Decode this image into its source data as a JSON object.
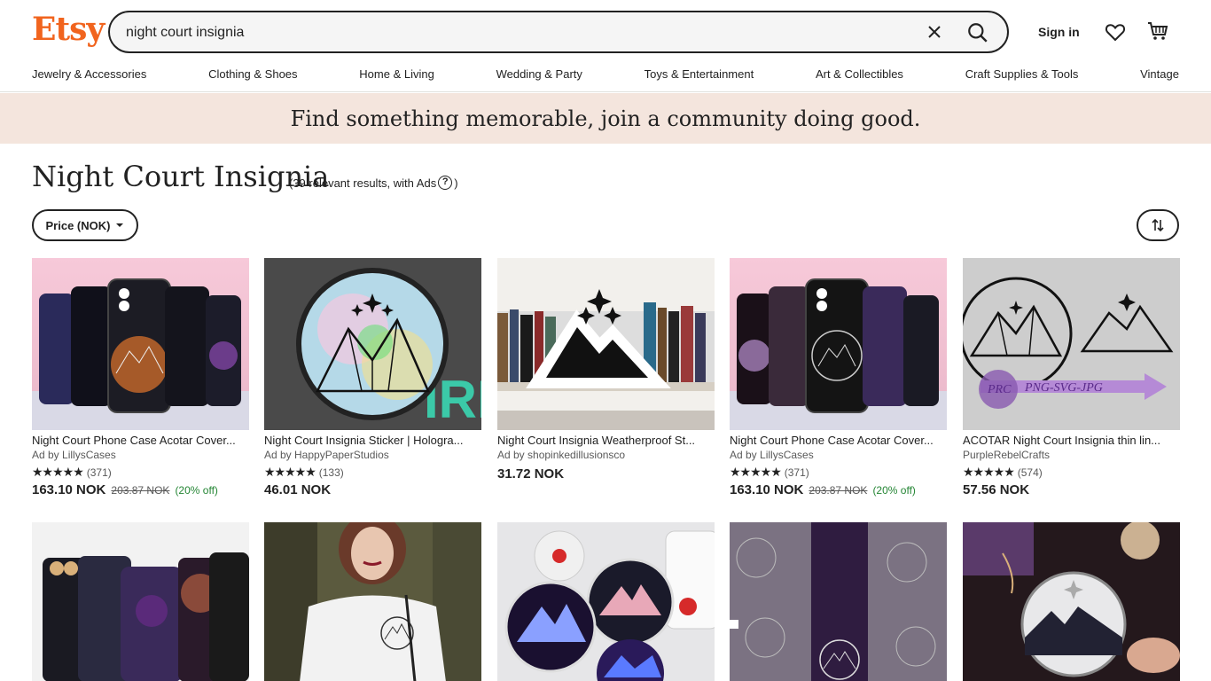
{
  "header": {
    "logo": "Etsy",
    "search_value": "night court insignia",
    "signin": "Sign in"
  },
  "nav": [
    "Jewelry & Accessories",
    "Clothing & Shoes",
    "Home & Living",
    "Wedding & Party",
    "Toys & Entertainment",
    "Art & Collectibles",
    "Craft Supplies & Tools",
    "Vintage"
  ],
  "banner": "Find something memorable, join a community doing good.",
  "page": {
    "title": "Night Court Insignia",
    "results": "(39 relevant results, with Ads",
    "results_close": ")",
    "filter_label": "Price (NOK)"
  },
  "products": [
    {
      "title": "Night Court Phone Case Acotar Cover...",
      "shop": "Ad by LillysCases",
      "stars": "★★★★★",
      "reviews": "(371)",
      "price": "163.10 NOK",
      "old_price": "203.87 NOK",
      "discount": "(20% off)"
    },
    {
      "title": "Night Court Insignia Sticker | Hologra...",
      "shop": "Ad by HappyPaperStudios",
      "stars": "★★★★★",
      "reviews": "(133)",
      "price": "46.01 NOK",
      "old_price": "",
      "discount": ""
    },
    {
      "title": "Night Court Insignia Weatherproof St...",
      "shop": "Ad by shopinkedillusionsco",
      "stars": "",
      "reviews": "",
      "price": "31.72 NOK",
      "old_price": "",
      "discount": ""
    },
    {
      "title": "Night Court Phone Case Acotar Cover...",
      "shop": "Ad by LillysCases",
      "stars": "★★★★★",
      "reviews": "(371)",
      "price": "163.10 NOK",
      "old_price": "203.87 NOK",
      "discount": "(20% off)"
    },
    {
      "title": "ACOTAR Night Court Insignia thin lin...",
      "shop": "PurpleRebelCrafts",
      "stars": "★★★★★",
      "reviews": "(574)",
      "price": "57.56 NOK",
      "old_price": "",
      "discount": ""
    }
  ],
  "thumb_text": {
    "svg_jpg": "PNG-SVG-JPG",
    "ring": "PRC"
  },
  "colors": {
    "brand": "#f1641e",
    "banner_bg": "#f4e5dd",
    "discount": "#258635"
  }
}
